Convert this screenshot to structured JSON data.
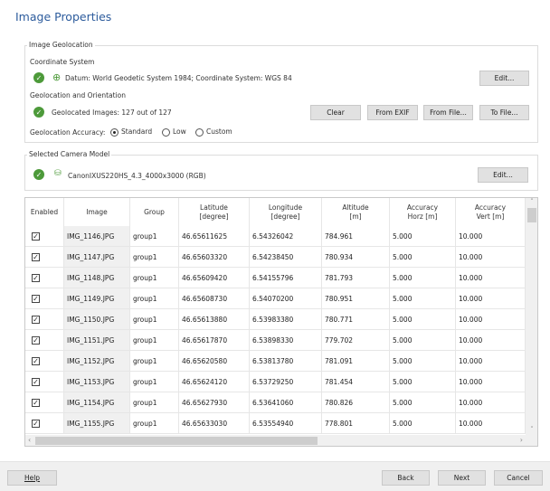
{
  "title": "Image Properties",
  "geolocation": {
    "legend": "Image Geolocation",
    "coord_label": "Coordinate System",
    "coord_text": "Datum: World Geodetic System 1984; Coordinate System: WGS 84",
    "edit": "Edit...",
    "orient_label": "Geolocation and Orientation",
    "geo_text": "Geolocated Images: 127 out of 127",
    "buttons": [
      "Clear",
      "From EXIF",
      "From File...",
      "To File..."
    ],
    "accuracy_label": "Geolocation Accuracy:",
    "accuracy_options": [
      "Standard",
      "Low",
      "Custom"
    ],
    "accuracy_selected": "Standard"
  },
  "camera": {
    "legend": "Selected Camera Model",
    "text": "CanonIXUS220HS_4.3_4000x3000 (RGB)",
    "edit": "Edit..."
  },
  "table": {
    "headers": [
      [
        "Enabled",
        ""
      ],
      [
        "Image",
        ""
      ],
      [
        "Group",
        ""
      ],
      [
        "Latitude",
        "[degree]"
      ],
      [
        "Longitude",
        "[degree]"
      ],
      [
        "Altitude",
        "[m]"
      ],
      [
        "Accuracy",
        "Horz [m]"
      ],
      [
        "Accuracy",
        "Vert [m]"
      ]
    ],
    "rows": [
      [
        true,
        "IMG_1146.JPG",
        "group1",
        "46.65611625",
        "6.54326042",
        "784.961",
        "5.000",
        "10.000"
      ],
      [
        true,
        "IMG_1147.JPG",
        "group1",
        "46.65603320",
        "6.54238450",
        "780.934",
        "5.000",
        "10.000"
      ],
      [
        true,
        "IMG_1148.JPG",
        "group1",
        "46.65609420",
        "6.54155796",
        "781.793",
        "5.000",
        "10.000"
      ],
      [
        true,
        "IMG_1149.JPG",
        "group1",
        "46.65608730",
        "6.54070200",
        "780.951",
        "5.000",
        "10.000"
      ],
      [
        true,
        "IMG_1150.JPG",
        "group1",
        "46.65613880",
        "6.53983380",
        "780.771",
        "5.000",
        "10.000"
      ],
      [
        true,
        "IMG_1151.JPG",
        "group1",
        "46.65617870",
        "6.53898330",
        "779.702",
        "5.000",
        "10.000"
      ],
      [
        true,
        "IMG_1152.JPG",
        "group1",
        "46.65620580",
        "6.53813780",
        "781.091",
        "5.000",
        "10.000"
      ],
      [
        true,
        "IMG_1153.JPG",
        "group1",
        "46.65624120",
        "6.53729250",
        "781.454",
        "5.000",
        "10.000"
      ],
      [
        true,
        "IMG_1154.JPG",
        "group1",
        "46.65627930",
        "6.53641060",
        "780.826",
        "5.000",
        "10.000"
      ],
      [
        true,
        "IMG_1155.JPG",
        "group1",
        "46.65633030",
        "6.53554940",
        "778.801",
        "5.000",
        "10.000"
      ]
    ]
  },
  "footer": {
    "help": "Help",
    "back": "Back",
    "next": "Next",
    "cancel": "Cancel"
  }
}
